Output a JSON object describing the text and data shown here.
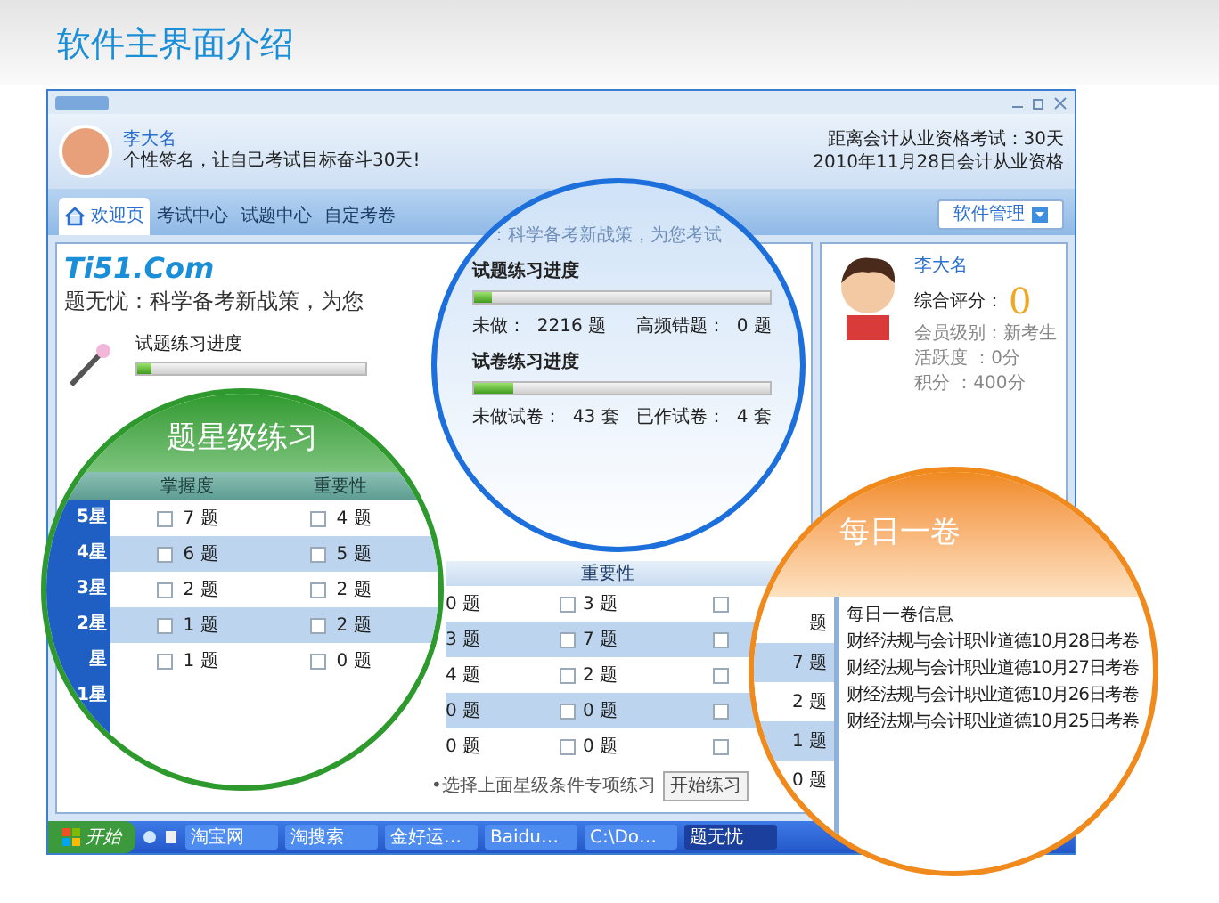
{
  "page_title": "软件主界面介绍",
  "user": {
    "name": "李大名",
    "signature": "个性签名，让自己考试目标奋斗30天!",
    "countdown": "距离会计从业资格考试：30天",
    "exam": "2010年11月28日会计从业资格"
  },
  "tabs": [
    {
      "label": "欢迎页",
      "selected": true
    },
    {
      "label": "考试中心",
      "selected": false
    },
    {
      "label": "试题中心",
      "selected": false
    },
    {
      "label": "自定考卷",
      "selected": false
    }
  ],
  "manage_button": "软件管理",
  "brand": "Ti51.Com",
  "slogan": "题无忧：科学备考新战策，为您",
  "practice": {
    "label": "试题练习进度",
    "level": 0.06
  },
  "table": {
    "header": "重要性",
    "rows": [
      {
        "cells": [
          {
            "text": "0 题"
          },
          {
            "text": "3 题",
            "checked": false
          },
          {
            "checked": false
          }
        ]
      },
      {
        "cells": [
          {
            "text": "3 题"
          },
          {
            "text": "7 题",
            "checked": false
          },
          {
            "checked": false
          }
        ]
      },
      {
        "cells": [
          {
            "text": "4 题"
          },
          {
            "text": "2 题",
            "checked": false
          },
          {
            "checked": false
          }
        ]
      },
      {
        "cells": [
          {
            "text": "0 题"
          },
          {
            "text": "0 题",
            "checked": false
          },
          {
            "checked": false
          }
        ]
      },
      {
        "cells": [
          {
            "text": "0 题"
          },
          {
            "text": "0 题",
            "checked": false
          },
          {
            "checked": false
          }
        ]
      }
    ],
    "hint": "•选择上面星级条件专项练习",
    "start_button": "开始练习"
  },
  "profile": {
    "name": "李大名",
    "score_label": "综合评分：",
    "score": "0",
    "lines": [
      "会员级别：新考生",
      "活跃度 ：0分",
      "积分 ：400分"
    ]
  },
  "taskbar": {
    "start": "开始",
    "tasks": [
      {
        "label": "淘宝网",
        "selected": false
      },
      {
        "label": "淘搜索",
        "selected": false
      },
      {
        "label": "金好运…",
        "selected": false
      },
      {
        "label": "Baidu…",
        "selected": false
      },
      {
        "label": "C:\\Do…",
        "selected": false
      },
      {
        "label": "题无忧",
        "selected": true
      }
    ]
  },
  "star_callout": {
    "title": "题星级练习",
    "columns": [
      "掌握度",
      "重要性"
    ],
    "rows": [
      {
        "label": "5星",
        "cells": [
          {
            "text": "7 题",
            "checked": false
          },
          {
            "text": "4 题",
            "checked": false
          }
        ]
      },
      {
        "label": "4星",
        "cells": [
          {
            "text": "6 题",
            "checked": false
          },
          {
            "text": "5 题",
            "checked": false
          }
        ]
      },
      {
        "label": "3星",
        "cells": [
          {
            "text": "2 题",
            "checked": false
          },
          {
            "text": "2 题",
            "checked": false
          }
        ]
      },
      {
        "label": "2星",
        "cells": [
          {
            "text": "1 题",
            "checked": false
          },
          {
            "text": "2 题",
            "checked": false
          }
        ]
      },
      {
        "label": "星",
        "cells": [
          {
            "text": "1 题",
            "checked": false
          },
          {
            "text": "0 题",
            "checked": false
          }
        ]
      }
    ],
    "extra_label": "1星"
  },
  "progress_callout": {
    "slogan": "：科学备考新战策，为您考试",
    "sections": [
      {
        "title": "试题练习进度",
        "level": 0.06,
        "left": "未做：  2216 题",
        "right": "高频错题：  0 题"
      },
      {
        "title": "试卷练习进度",
        "level": 0.13,
        "left": "未做试卷：  43 套",
        "right": "已作试卷：  4 套"
      }
    ]
  },
  "daily_callout": {
    "title": "每日一卷",
    "counts": [
      "题",
      "7 题",
      "2 题",
      "1 题",
      "0 题"
    ],
    "heading": "每日一卷信息",
    "items": [
      "财经法规与会计职业道德10月28日考卷",
      "财经法规与会计职业道德10月27日考卷",
      "财经法规与会计职业道德10月26日考卷",
      "财经法规与会计职业道德10月25日考卷"
    ]
  }
}
